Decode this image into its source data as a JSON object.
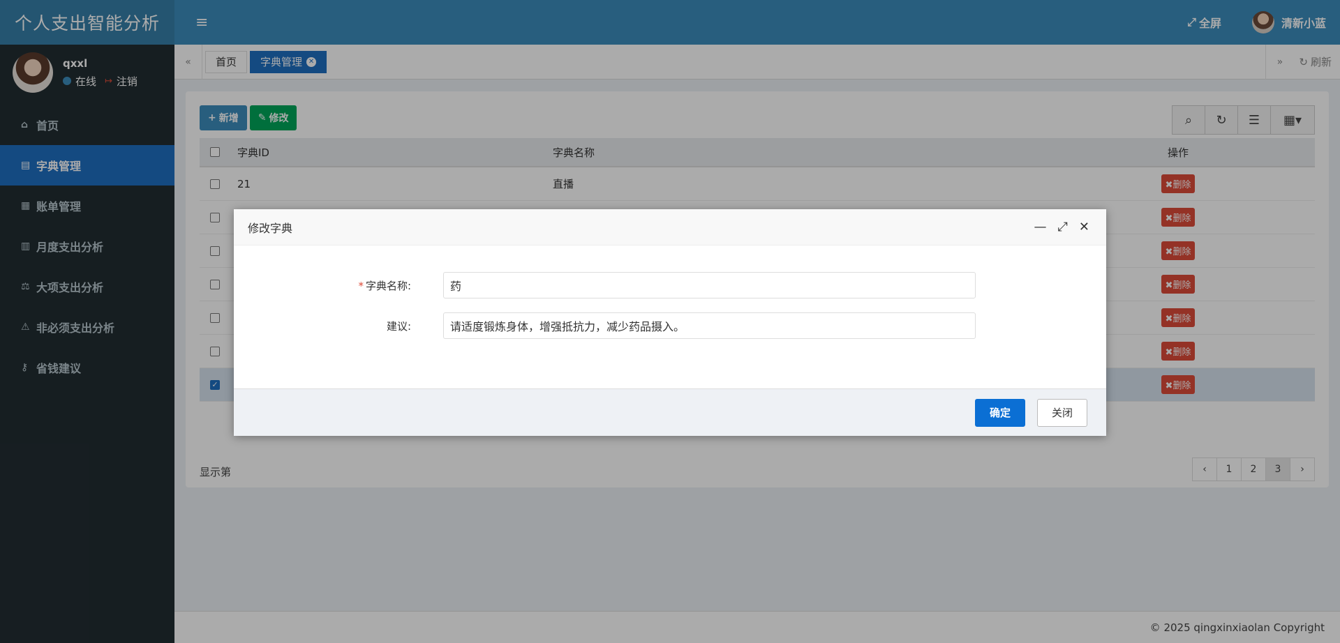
{
  "header": {
    "title": "个人支出智能分析",
    "fullscreen_label": "全屏",
    "user_name": "清新小蓝"
  },
  "sidebar": {
    "user": {
      "name": "qxxl",
      "status": "在线",
      "logout": "注销"
    },
    "items": [
      {
        "label": "首页",
        "icon": "home-icon"
      },
      {
        "label": "字典管理",
        "icon": "book-icon",
        "active": true
      },
      {
        "label": "账单管理",
        "icon": "calculator-icon"
      },
      {
        "label": "月度支出分析",
        "icon": "calendar-icon"
      },
      {
        "label": "大项支出分析",
        "icon": "balance-scale-icon"
      },
      {
        "label": "非必须支出分析",
        "icon": "warning-icon"
      },
      {
        "label": "省钱建议",
        "icon": "key-icon"
      }
    ]
  },
  "tabs": {
    "items": [
      {
        "label": "首页"
      },
      {
        "label": "字典管理",
        "active": true
      }
    ],
    "refresh_label": "刷新"
  },
  "toolbar": {
    "add_label": "新增",
    "edit_label": "修改"
  },
  "table": {
    "headers": {
      "id": "字典ID",
      "name": "字典名称",
      "op": "操作"
    },
    "rows": [
      {
        "id": "21",
        "name": "直播",
        "selected": false
      },
      {
        "id": "",
        "name": "",
        "selected": false
      },
      {
        "id": "",
        "name": "",
        "selected": false
      },
      {
        "id": "",
        "name": "",
        "selected": false
      },
      {
        "id": "",
        "name": "",
        "selected": false
      },
      {
        "id": "",
        "name": "",
        "selected": false
      },
      {
        "id": "",
        "name": "",
        "selected": true
      }
    ],
    "delete_label": "删除",
    "showing_text": "显示第"
  },
  "pagination": {
    "prev": "‹",
    "pages": [
      "1",
      "2",
      "3"
    ],
    "current": "3",
    "next": "›"
  },
  "footer": {
    "copyright": "© 2025 qingxinxiaolan Copyright"
  },
  "modal": {
    "title": "修改字典",
    "fields": {
      "name_label": "字典名称:",
      "name_value": "药",
      "advice_label": "建议:",
      "advice_value": "请适度锻炼身体，增强抵抗力，减少药品摄入。"
    },
    "ok_label": "确定",
    "close_label": "关闭"
  }
}
